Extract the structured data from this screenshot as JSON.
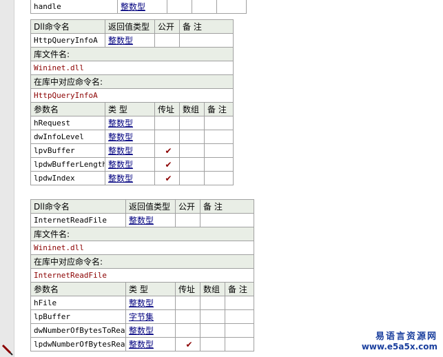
{
  "top_fragment": {
    "name": "handle",
    "type": "整数型"
  },
  "tables": [
    {
      "headers": {
        "dll_name": "Dll命令名",
        "return_type": "返回值类型",
        "public": "公开",
        "note": "备 注",
        "lib": "库文件名:",
        "entry": "在库中对应命令名:",
        "param_name": "参数名",
        "param_type": "类 型",
        "byref": "传址",
        "array": "数组"
      },
      "command": "HttpQueryInfoA",
      "return_type": "整数型",
      "library": "Wininet.dll",
      "entry_name": "HttpQueryInfoA",
      "params": [
        {
          "name": "hRequest",
          "type": "整数型",
          "byref": ""
        },
        {
          "name": "dwInfoLevel",
          "type": "整数型",
          "byref": ""
        },
        {
          "name": "lpvBuffer",
          "type": "整数型",
          "byref": "✔"
        },
        {
          "name": "lpdwBufferLength",
          "type": "整数型",
          "byref": "✔"
        },
        {
          "name": "lpdwIndex",
          "type": "整数型",
          "byref": "✔"
        }
      ]
    },
    {
      "headers": {
        "dll_name": "Dll命令名",
        "return_type": "返回值类型",
        "public": "公开",
        "note": "备 注",
        "lib": "库文件名:",
        "entry": "在库中对应命令名:",
        "param_name": "参数名",
        "param_type": "类 型",
        "byref": "传址",
        "array": "数组"
      },
      "command": "InternetReadFile",
      "return_type": "整数型",
      "library": "Wininet.dll",
      "entry_name": "InternetReadFile",
      "params": [
        {
          "name": "hFile",
          "type": "整数型",
          "byref": ""
        },
        {
          "name": "lpBuffer",
          "type": "字节集",
          "byref": ""
        },
        {
          "name": "dwNumberOfBytesToRead",
          "type": "整数型",
          "byref": ""
        },
        {
          "name": "lpdwNumberOfBytesRead",
          "type": "整数型",
          "byref": "✔"
        }
      ]
    }
  ],
  "watermark": {
    "title": "易语言资源网",
    "url": "www.e5a5x.com"
  },
  "icons": {
    "gutter": "pen-icon",
    "check": "checkmark-icon"
  },
  "colors": {
    "header_bg": "#e9eee6",
    "link": "#00007f",
    "lib_text": "#8b0000",
    "watermark": "#1a3f9e"
  }
}
